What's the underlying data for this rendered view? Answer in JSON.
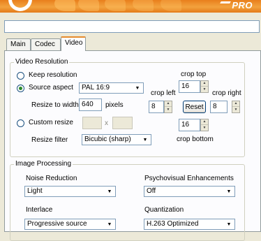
{
  "app": {
    "brand": "PRO"
  },
  "tabs": [
    {
      "label": "Main"
    },
    {
      "label": "Codec"
    },
    {
      "label": "Video"
    }
  ],
  "video_resolution": {
    "title": "Video Resolution",
    "keep_resolution_label": "Keep resolution",
    "source_aspect_label": "Source aspect",
    "source_aspect_value": "PAL 16:9",
    "resize_to_width_label": "Resize to width",
    "resize_to_width_value": "640",
    "pixels_label": "pixels",
    "custom_resize_label": "Custom  resize",
    "custom_x_label": "x",
    "resize_filter_label": "Resize filter",
    "resize_filter_value": "Bicubic (sharp)",
    "crop_top_label": "crop top",
    "crop_top_value": "16",
    "crop_left_label": "crop left",
    "crop_left_value": "8",
    "crop_right_label": "crop right",
    "crop_right_value": "8",
    "crop_bottom_label": "crop bottom",
    "crop_bottom_value": "16",
    "reset_label": "Reset",
    "selected": "source_aspect"
  },
  "image_processing": {
    "title": "Image Processing",
    "noise_reduction_label": "Noise Reduction",
    "noise_reduction_value": "Light",
    "psychovisual_label": "Psychovisual Enhancements",
    "psychovisual_value": "Off",
    "interlace_label": "Interlace",
    "interlace_value": "Progressive source",
    "quantization_label": "Quantization",
    "quantization_value": "H.263 Optimized"
  },
  "icons": {
    "logo": "swirl-logo-icon",
    "dropdown": "chevron-down-icon",
    "spin_up": "arrow-up-icon",
    "spin_down": "arrow-down-icon"
  }
}
